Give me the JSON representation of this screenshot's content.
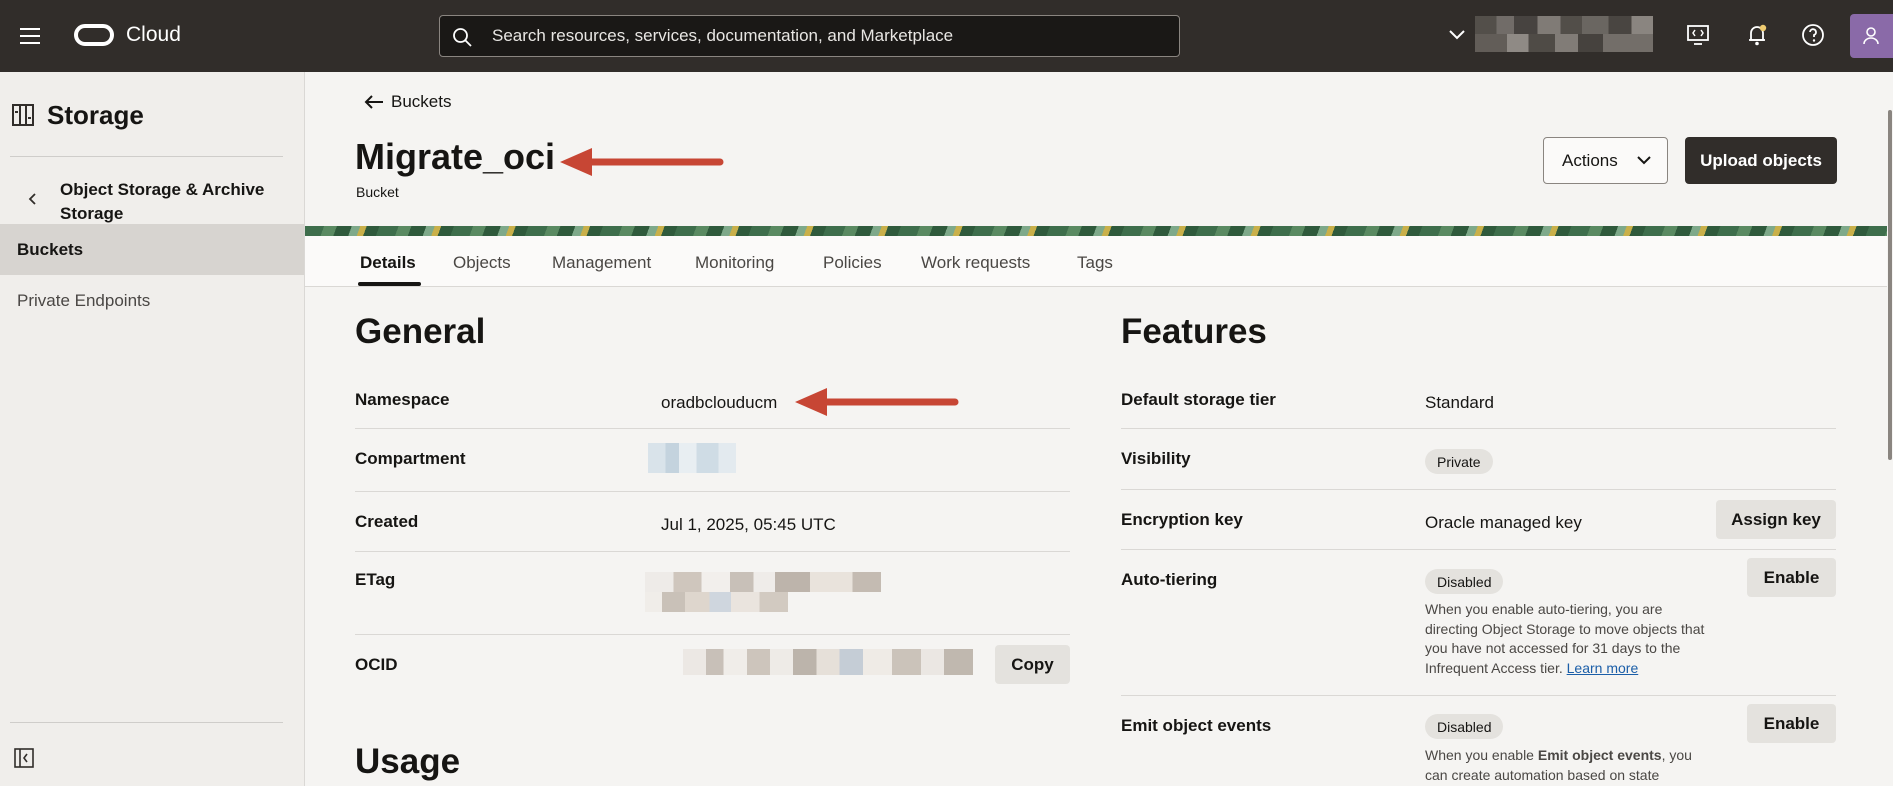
{
  "topbar": {
    "brand": "Cloud",
    "search_placeholder": "Search resources, services, documentation, and Marketplace"
  },
  "sidebar": {
    "heading": "Storage",
    "parent": "Object Storage & Archive Storage",
    "items": [
      {
        "label": "Buckets",
        "active": true
      },
      {
        "label": "Private Endpoints",
        "active": false
      }
    ]
  },
  "header": {
    "back_label": "Buckets",
    "title": "Migrate_oci",
    "subtitle": "Bucket",
    "actions_label": "Actions",
    "upload_label": "Upload objects"
  },
  "tabs": [
    "Details",
    "Objects",
    "Management",
    "Monitoring",
    "Policies",
    "Work requests",
    "Tags"
  ],
  "general": {
    "title": "General",
    "namespace_label": "Namespace",
    "namespace_value": "oradbclouducm",
    "compartment_label": "Compartment",
    "created_label": "Created",
    "created_value": "Jul 1, 2025, 05:45 UTC",
    "etag_label": "ETag",
    "ocid_label": "OCID",
    "copy_label": "Copy"
  },
  "usage": {
    "title": "Usage"
  },
  "features": {
    "title": "Features",
    "tier_label": "Default storage tier",
    "tier_value": "Standard",
    "visibility_label": "Visibility",
    "visibility_value": "Private",
    "encryption_label": "Encryption key",
    "encryption_value": "Oracle managed key",
    "assign_key_label": "Assign key",
    "autotier_label": "Auto-tiering",
    "autotier_status": "Disabled",
    "autotier_enable": "Enable",
    "autotier_desc": "When you enable auto-tiering, you are directing Object Storage to move objects that you have not accessed for 31 days to the Infrequent Access tier.",
    "learn_more": "Learn more",
    "events_label": "Emit object events",
    "events_status": "Disabled",
    "events_enable": "Enable",
    "events_desc_prefix": "When you enable ",
    "events_desc_bold": "Emit object events",
    "events_desc_suffix": ", you can create automation based on state"
  },
  "colors": {
    "topbar": "#312d2a",
    "annotation_arrow": "#c74634",
    "link": "#1b5ea8"
  }
}
